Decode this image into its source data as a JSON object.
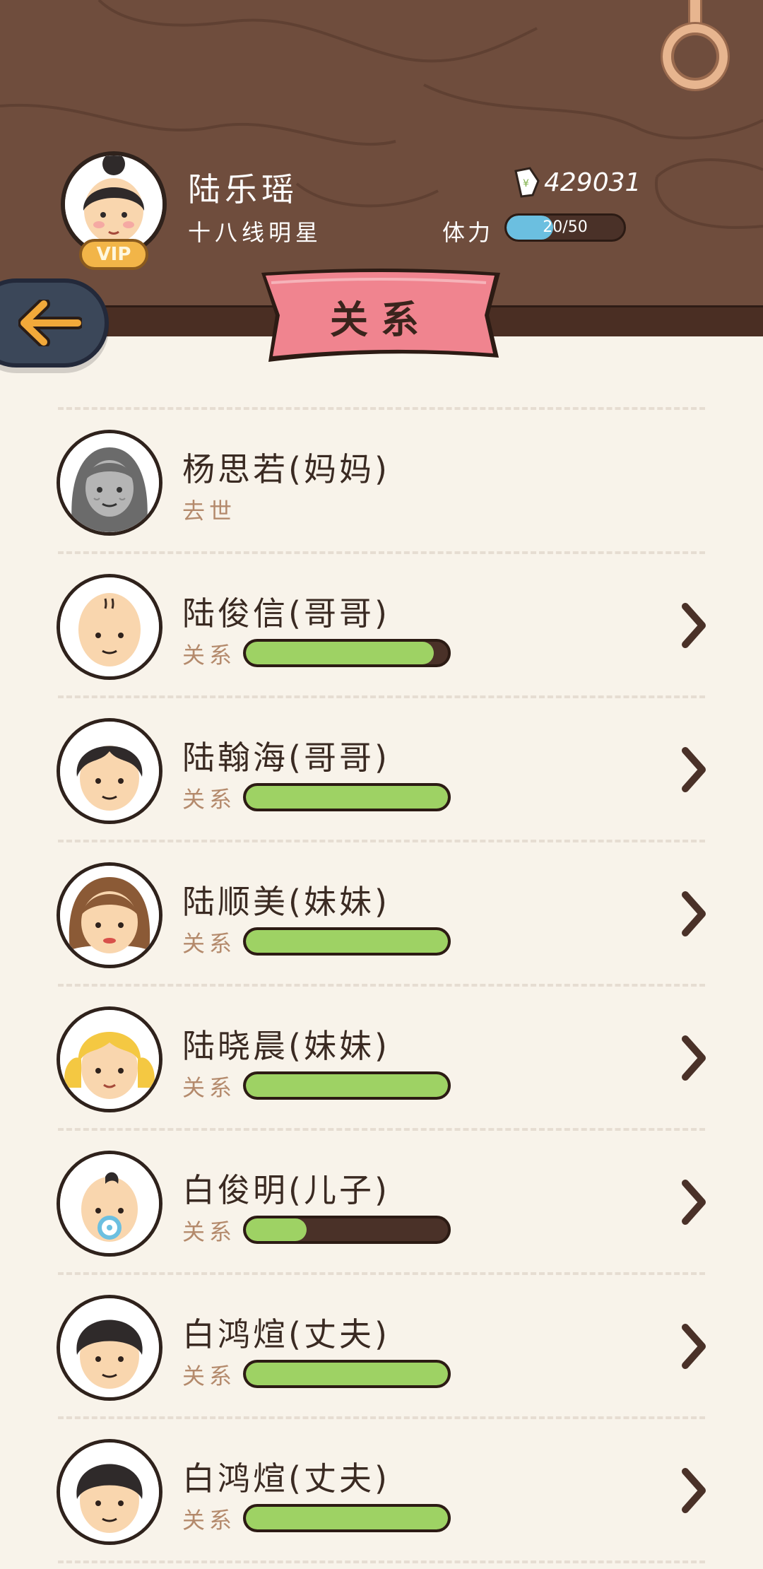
{
  "header": {
    "player_name": "陆乐瑶",
    "player_rank": "十八线明星",
    "vip_label": "VIP",
    "coins": "429031",
    "stamina_label": "体力",
    "stamina_text": "20/50",
    "stamina_fraction": 0.4
  },
  "title": "关系",
  "relation_label": "关系",
  "relations": [
    {
      "name": "杨思若(妈妈)",
      "status": "去世",
      "level": null,
      "avatar": "elder-woman"
    },
    {
      "name": "陆俊信(哥哥)",
      "status": "",
      "level": 0.93,
      "avatar": "bald-man"
    },
    {
      "name": "陆翰海(哥哥)",
      "status": "",
      "level": 1.0,
      "avatar": "man-dark-hair"
    },
    {
      "name": "陆顺美(妹妹)",
      "status": "",
      "level": 1.0,
      "avatar": "woman-brown-hair"
    },
    {
      "name": "陆晓晨(妹妹)",
      "status": "",
      "level": 1.0,
      "avatar": "girl-blonde-pigtails"
    },
    {
      "name": "白俊明(儿子)",
      "status": "",
      "level": 0.3,
      "avatar": "baby-pacifier"
    },
    {
      "name": "白鸿煊(丈夫)",
      "status": "",
      "level": 1.0,
      "avatar": "man-black-hair"
    },
    {
      "name": "白鸿煊(丈夫)",
      "status": "",
      "level": 1.0,
      "avatar": "man-black-hair"
    }
  ],
  "colors": {
    "wood": "#6f4d3d",
    "ribbon": "#f0848f",
    "bar_fill": "#9ed264",
    "bar_track": "#4a3128",
    "stamina_fill": "#6bbfe0",
    "background": "#f8f3ea"
  },
  "icons": [
    "back-arrow-icon",
    "chevron-right-icon",
    "coin-ticket-icon",
    "ring-icon"
  ]
}
